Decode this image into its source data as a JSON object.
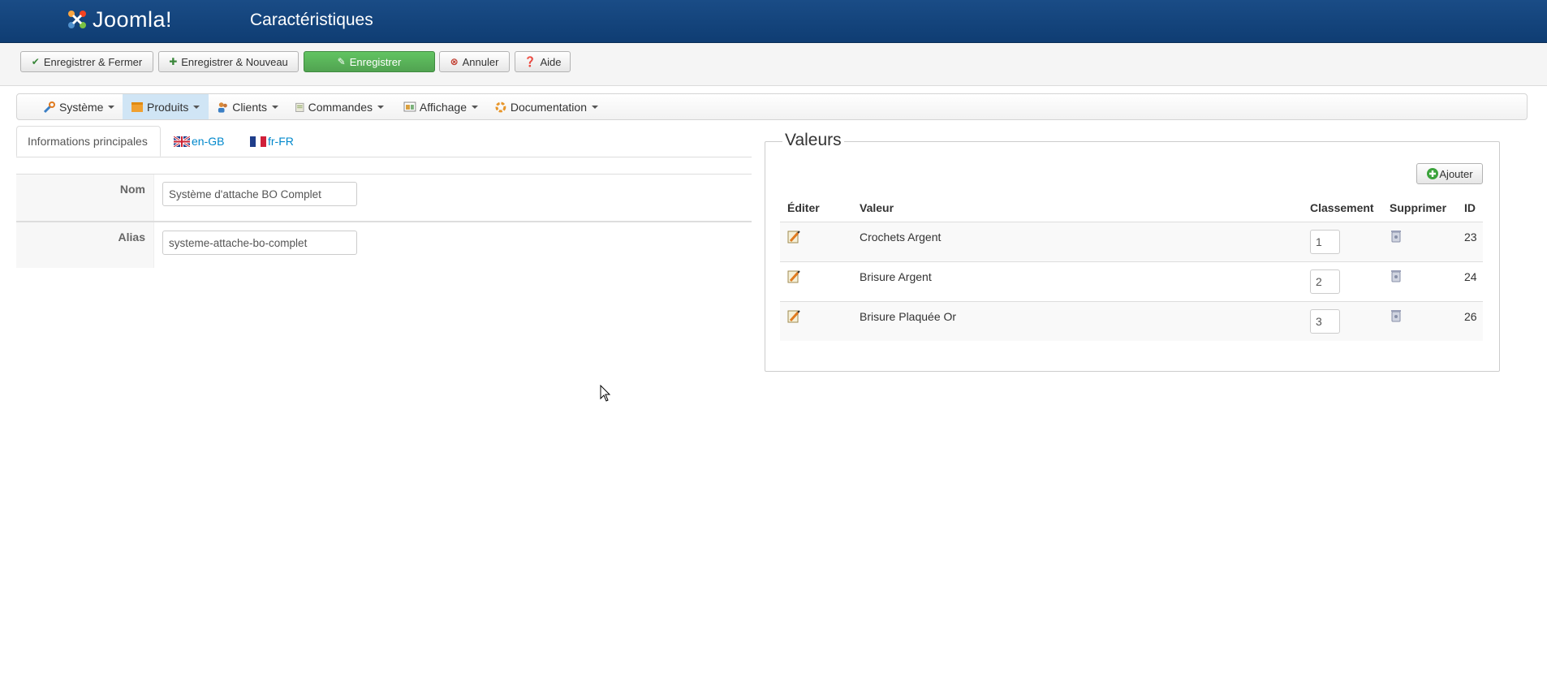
{
  "header": {
    "logo_text": "Joomla!",
    "page_title": "Caractéristiques"
  },
  "toolbar": {
    "save_close": "Enregistrer & Fermer",
    "save_new": "Enregistrer & Nouveau",
    "save": "Enregistrer",
    "cancel": "Annuler",
    "help": "Aide"
  },
  "menu": {
    "items": [
      {
        "label": "Système",
        "icon": "wrench-icon"
      },
      {
        "label": "Produits",
        "icon": "products-icon"
      },
      {
        "label": "Clients",
        "icon": "users-icon"
      },
      {
        "label": "Commandes",
        "icon": "orders-icon"
      },
      {
        "label": "Affichage",
        "icon": "display-icon"
      },
      {
        "label": "Documentation",
        "icon": "documentation-icon"
      }
    ],
    "active": "Produits"
  },
  "tabs": {
    "main": "Informations principales",
    "lang1": "en-GB",
    "lang2": "fr-FR"
  },
  "form": {
    "nom_label": "Nom",
    "nom_value": "Système d'attache BO Complet",
    "alias_label": "Alias",
    "alias_value": "systeme-attache-bo-complet"
  },
  "values": {
    "legend": "Valeurs",
    "add_label": "Ajouter",
    "columns": {
      "edit": "Éditer",
      "value": "Valeur",
      "order": "Classement",
      "delete": "Supprimer",
      "id": "ID"
    },
    "rows": [
      {
        "value": "Crochets Argent",
        "order": "1",
        "id": "23"
      },
      {
        "value": "Brisure Argent",
        "order": "2",
        "id": "24"
      },
      {
        "value": "Brisure Plaquée Or",
        "order": "3",
        "id": "26"
      }
    ]
  },
  "colors": {
    "header_bg": "#124178",
    "save_green": "#51a351",
    "link_blue": "#0088cc",
    "active_menu": "#d0e5f5"
  }
}
